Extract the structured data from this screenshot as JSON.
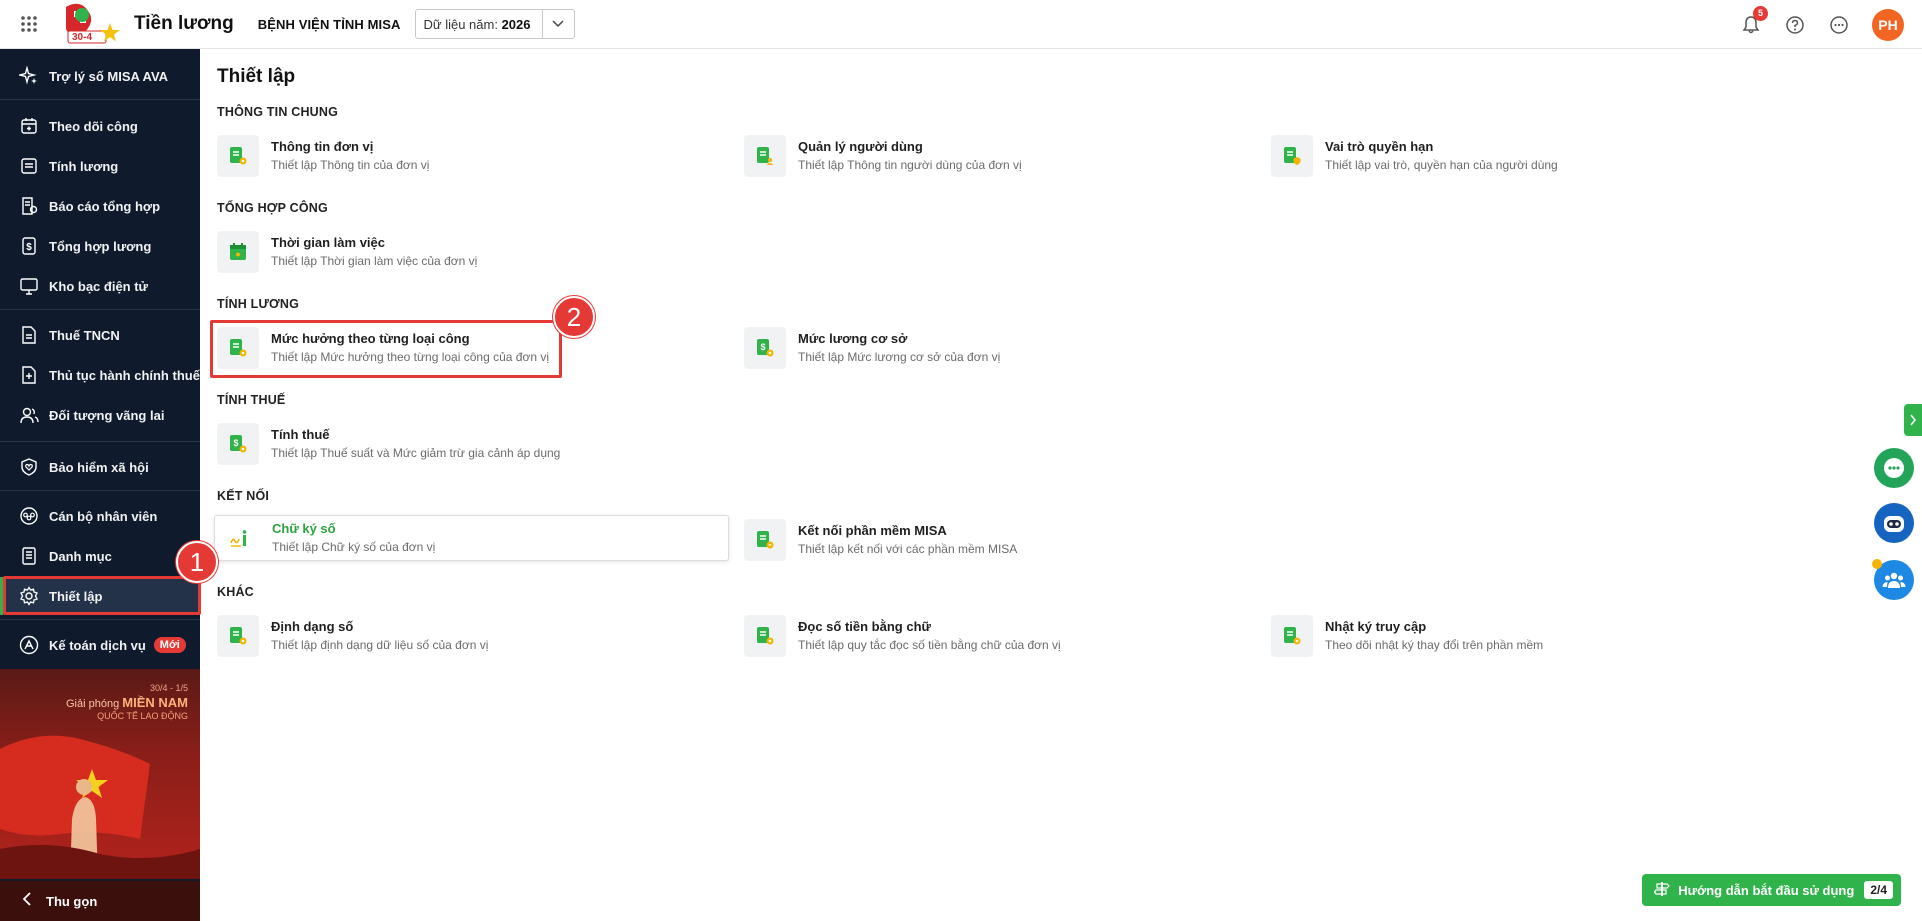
{
  "app": {
    "title": "Tiền lương",
    "org_name": "BỆNH VIỆN TỈNH MISA",
    "year_label": "Dữ liệu năm:",
    "year_value": "2026",
    "logo_text": "30-4",
    "notification_count": "5",
    "avatar_initials": "PH"
  },
  "sidebar": {
    "items": [
      {
        "label": "Trợ lý số MISA AVA",
        "icon": "sparkle-icon"
      },
      {
        "label": "Theo dõi công",
        "icon": "calendar-icon"
      },
      {
        "label": "Tính lương",
        "icon": "document-icon"
      },
      {
        "label": "Báo cáo tổng hợp",
        "icon": "report-icon"
      },
      {
        "label": "Tổng hợp lương",
        "icon": "money-icon"
      },
      {
        "label": "Kho bạc điện tử",
        "icon": "monitor-icon"
      },
      {
        "label": "Thuế TNCN",
        "icon": "tax-doc-icon"
      },
      {
        "label": "Thủ tục hành chính thuế",
        "icon": "doc-plus-icon"
      },
      {
        "label": "Đối tượng vãng lai",
        "icon": "users-icon"
      },
      {
        "label": "Bảo hiểm xã hội",
        "icon": "shield-heart-icon"
      },
      {
        "label": "Cán bộ nhân viên",
        "icon": "staff-icon"
      },
      {
        "label": "Danh mục",
        "icon": "list-icon"
      },
      {
        "label": "Thiết lập",
        "icon": "gear-icon"
      },
      {
        "label": "Kế toán dịch vụ",
        "icon": "triangle-icon",
        "badge": "Mới"
      }
    ],
    "poster": {
      "line1": "30/4 - 1/5",
      "line2_prefix": "Giải phóng",
      "line2_emph": "MIỀN NAM",
      "line3": "QUỐC TẾ LAO ĐỘNG"
    },
    "collapse_label": "Thu gọn"
  },
  "main": {
    "page_title": "Thiết lập",
    "sections": [
      {
        "title": "THÔNG TIN CHUNG"
      },
      {
        "title": "TỔNG HỢP CÔNG"
      },
      {
        "title": "TÍNH LƯƠNG"
      },
      {
        "title": "TÍNH THUẾ"
      },
      {
        "title": "KẾT NỐI"
      },
      {
        "title": "KHÁC"
      }
    ],
    "cards": [
      {
        "title": "Thông tin đơn vị",
        "desc": "Thiết lập Thông tin của đơn vị"
      },
      {
        "title": "Quản lý người dùng",
        "desc": "Thiết lập Thông tin người dùng của đơn vị"
      },
      {
        "title": "Vai trò quyền hạn",
        "desc": "Thiết lập vai trò, quyền hạn của người dùng"
      },
      {
        "title": "Thời gian làm việc",
        "desc": "Thiết lập Thời gian làm việc của đơn vị"
      },
      {
        "title": "Mức hưởng theo từng loại công",
        "desc": "Thiết lập Mức hưởng theo từng loại công của đơn vị"
      },
      {
        "title": "Mức lương cơ sở",
        "desc": "Thiết lập Mức lương cơ sở của đơn vị"
      },
      {
        "title": "Tính thuế",
        "desc": "Thiết lập Thuế suất và Mức giảm trừ gia cảnh áp dụng"
      },
      {
        "title": "Chữ ký số",
        "desc": "Thiết lập Chữ ký số của đơn vị"
      },
      {
        "title": "Kết nối phần mềm MISA",
        "desc": "Thiết lập kết nối với các phần mềm MISA"
      },
      {
        "title": "Định dạng số",
        "desc": "Thiết lập định dạng dữ liệu số của đơn vị"
      },
      {
        "title": "Đọc số tiền bằng chữ",
        "desc": "Thiết lập quy tắc đọc số tiền bằng chữ của đơn vị"
      },
      {
        "title": "Nhật ký truy cập",
        "desc": "Theo dõi nhật ký thay đổi trên phần mềm"
      }
    ]
  },
  "annotations": {
    "step1": "1",
    "step2": "2"
  },
  "guide": {
    "label": "Hướng dẫn bắt đầu sử dụng",
    "progress": "2/4"
  },
  "colors": {
    "accent_green": "#2fb34a",
    "sidebar_bg": "#0f1a2c",
    "annotation_red": "#e53935",
    "avatar_orange": "#f26522"
  }
}
